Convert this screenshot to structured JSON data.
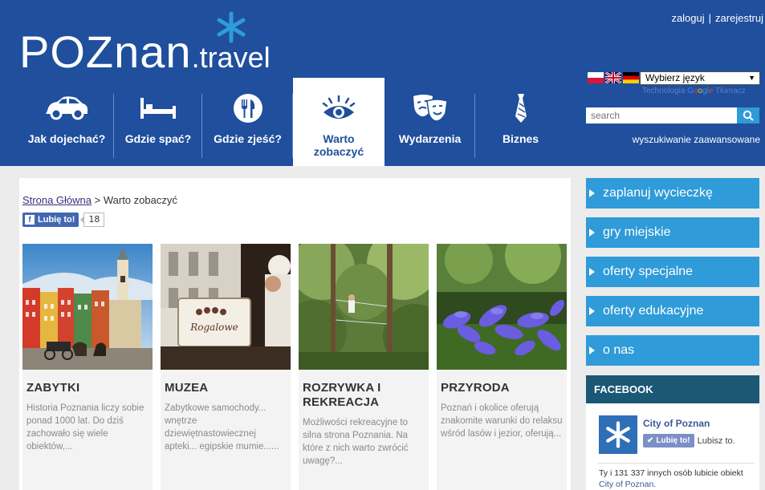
{
  "header": {
    "logo_main": "POZnan",
    "logo_suffix": ".travel",
    "login": "zaloguj",
    "separator": "|",
    "register": "zarejestruj",
    "language_select": "Wybierz język",
    "translate_prefix": "Technologia",
    "translate_g1": "G",
    "translate_g2": "o",
    "translate_g3": "o",
    "translate_g4": "g",
    "translate_g5": "l",
    "translate_g6": "e",
    "translate_suffix": "Tłumacz",
    "search_placeholder": "search",
    "advanced_search": "wyszukiwanie zaawansowane"
  },
  "nav": [
    {
      "label": "Jak dojechać?",
      "icon": "car-icon"
    },
    {
      "label": "Gdzie spać?",
      "icon": "bed-icon"
    },
    {
      "label": "Gdzie zjeść?",
      "icon": "fork-knife-icon"
    },
    {
      "label": "Warto zobaczyć",
      "icon": "eye-icon"
    },
    {
      "label": "Wydarzenia",
      "icon": "theater-masks-icon"
    },
    {
      "label": "Biznes",
      "icon": "tie-icon"
    }
  ],
  "breadcrumb": {
    "home": "Strona Główna",
    "sep": ">",
    "current": "Warto zobaczyć"
  },
  "like": {
    "label": "Lubię to!",
    "count": "18"
  },
  "cards": [
    {
      "title": "ZABYTKI",
      "desc": "Historia Poznania liczy sobie ponad 1000 lat. Do dziś zachowało się wiele obiektów,..."
    },
    {
      "title": "MUZEA",
      "desc": "Zabytkowe samochody... wnętrze dziewiętnastowiecznej apteki... egipskie mumie......"
    },
    {
      "title": "ROZRYWKA I REKREACJA",
      "desc": "Możliwości rekreacyjne to silna strona Poznania. Na które z nich warto zwrócić uwagę?..."
    },
    {
      "title": "PRZYRODA",
      "desc": "Poznań i okolice oferują znakomite warunki do relaksu wśród lasów i jezior, oferują..."
    }
  ],
  "muzea_sign": "Rogalowe",
  "sidebar": [
    "zaplanuj wycieczkę",
    "gry miejskie",
    "oferty specjalne",
    "oferty edukacyjne",
    "o nas"
  ],
  "facebook": {
    "heading": "FACEBOOK",
    "page_name": "City of Poznan",
    "like_label": "Lubię to!",
    "lubisz": "Lubisz to.",
    "text": "Ty i 131 337 innych osób lubicie obiekt",
    "page_link": "City of Poznan."
  },
  "colors": {
    "header_blue": "#1f4f9d",
    "accent_cyan": "#2f9bd8",
    "facebook_head": "#1a5876"
  }
}
